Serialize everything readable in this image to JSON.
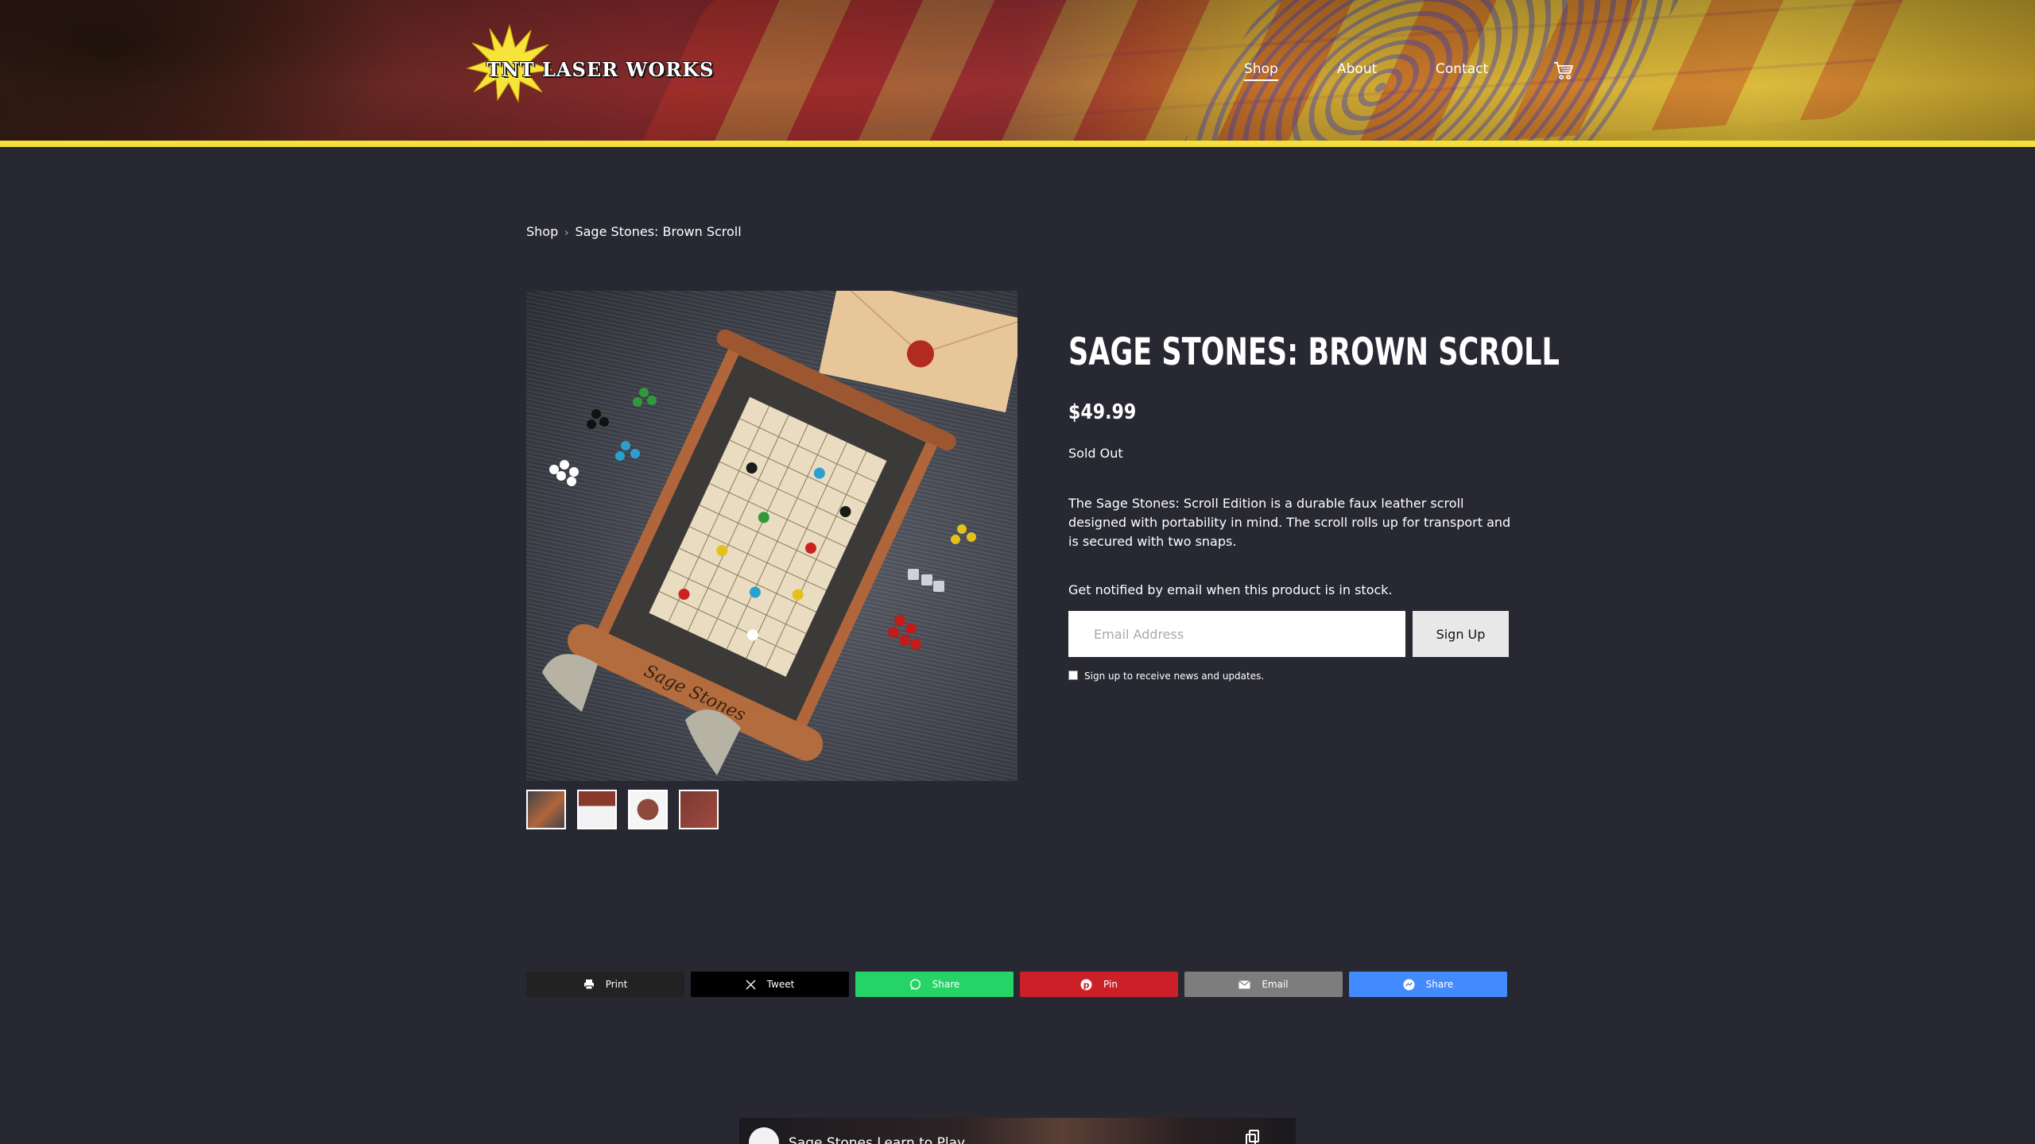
{
  "header": {
    "logo_text": "TNT LASER WORKS",
    "nav": [
      {
        "label": "Shop",
        "active": true
      },
      {
        "label": "About",
        "active": false
      },
      {
        "label": "Contact",
        "active": false
      }
    ],
    "cart_icon": "cart-icon",
    "accent_color": "#f4e13a"
  },
  "breadcrumb": {
    "root": "Shop",
    "separator": "›",
    "current": "Sage Stones: Brown Scroll"
  },
  "product": {
    "title": "SAGE STONES: BROWN SCROLL",
    "price": "$49.99",
    "stock_status": "Sold Out",
    "description": "The Sage Stones: Scroll Edition is a durable faux leather scroll designed with portability in mind. The scroll rolls up for transport and is secured with two snaps.",
    "notify_text": "Get notified by email when this product is in stock.",
    "email_placeholder": "Email Address",
    "signup_label": "Sign Up",
    "newsletter_label": "Sign up to receive news and updates.",
    "thumbnail_count": 4,
    "scroll_label": "Sage Stones"
  },
  "share": [
    {
      "label": "Print",
      "icon": "print-icon",
      "color": "#222222"
    },
    {
      "label": "Tweet",
      "icon": "x-icon",
      "color": "#000000"
    },
    {
      "label": "Share",
      "icon": "whatsapp-icon",
      "color": "#25d366"
    },
    {
      "label": "Pin",
      "icon": "pinterest-icon",
      "color": "#cb2027"
    },
    {
      "label": "Email",
      "icon": "email-icon",
      "color": "#7d7d7d"
    },
    {
      "label": "Share",
      "icon": "messenger-icon",
      "color": "#448aff"
    }
  ],
  "video": {
    "title": "Sage Stones Learn to Play"
  }
}
